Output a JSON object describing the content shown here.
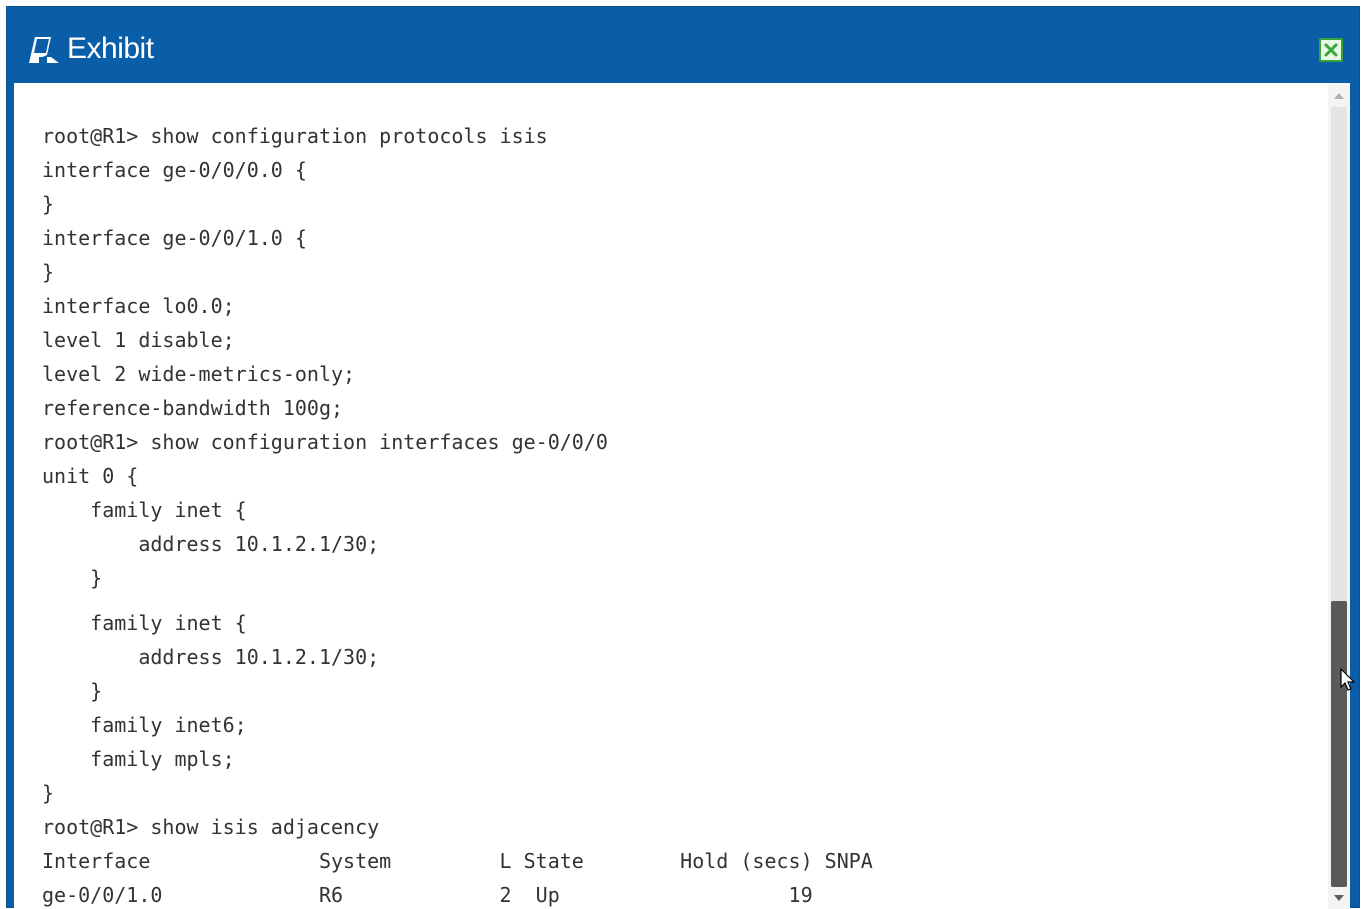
{
  "window": {
    "title": "Exhibit",
    "title_icon": "exhibit-icon",
    "close_icon": "close-icon",
    "accent_color": "#0a5ea8",
    "close_color": "#37a33a"
  },
  "terminal": {
    "lines": [
      "root@R1> show configuration protocols isis",
      "interface ge-0/0/0.0 {",
      "}",
      "interface ge-0/0/1.0 {",
      "}",
      "interface lo0.0;",
      "level 1 disable;",
      "level 2 wide-metrics-only;",
      "reference-bandwidth 100g;",
      "root@R1> show configuration interfaces ge-0/0/0",
      "unit 0 {",
      "    family inet {",
      "        address 10.1.2.1/30;",
      "    }",
      "    family inet {",
      "        address 10.1.2.1/30;",
      "    }",
      "    family inet6;",
      "    family mpls;",
      "}",
      "root@R1> show isis adjacency",
      "Interface              System         L State        Hold (secs) SNPA",
      "ge-0/0/1.0             R6             2  Up                   19"
    ]
  },
  "scrollbar": {
    "position_fraction": 0.63
  }
}
